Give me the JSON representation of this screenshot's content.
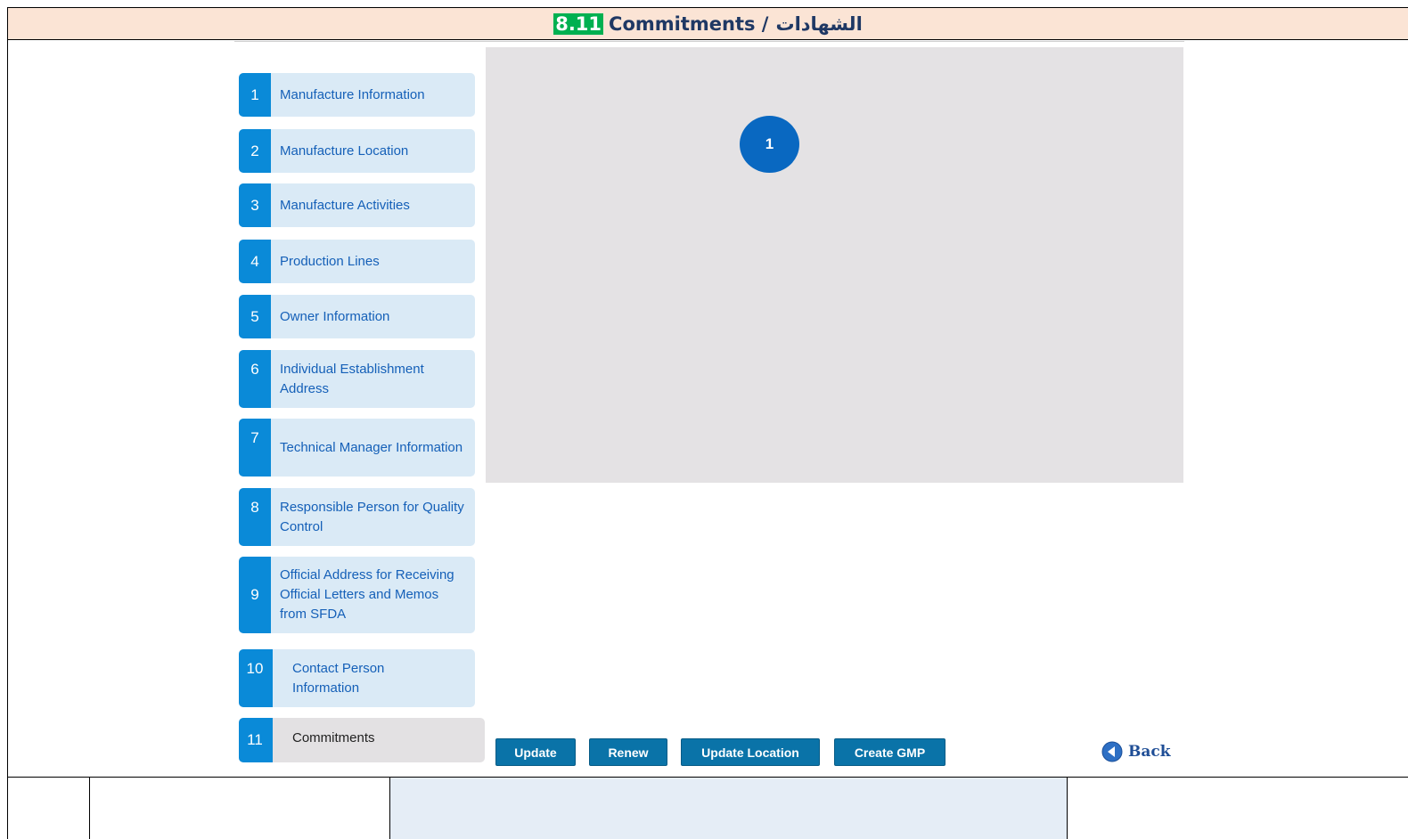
{
  "header": {
    "number": "8.11",
    "title": "Commitments /",
    "arabic": "الشهادات"
  },
  "steps": [
    {
      "num": "1",
      "label": "Manufacture Information"
    },
    {
      "num": "2",
      "label": "Manufacture Location"
    },
    {
      "num": "3",
      "label": "Manufacture Activities"
    },
    {
      "num": "4",
      "label": "Production Lines"
    },
    {
      "num": "5",
      "label": "Owner Information"
    },
    {
      "num": "6",
      "label": "Individual Establishment Address"
    },
    {
      "num": "7",
      "label": "Technical Manager Information"
    },
    {
      "num": "8",
      "label": "Responsible Person for Quality Control"
    },
    {
      "num": "9",
      "label": "Official Address for Receiving Official Letters and Memos from SFDA"
    },
    {
      "num": "10",
      "label": "Contact Person Information"
    },
    {
      "num": "11",
      "label": "Commitments",
      "active": true
    }
  ],
  "marker": "1",
  "buttons": {
    "update": "Update",
    "renew": "Renew",
    "update_location": "Update Location",
    "create_gmp": "Create GMP",
    "back": "Back"
  },
  "colors": {
    "step_badge": "#0a8ad8",
    "step_bg": "#daeaf6",
    "button": "#0a73a8",
    "header_bg": "#fbe4d5",
    "number_highlight": "#00b050"
  }
}
